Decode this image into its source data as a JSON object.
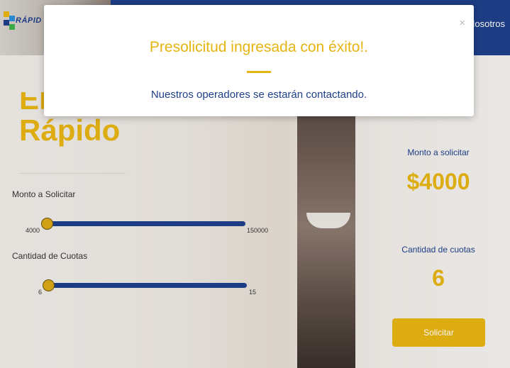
{
  "header": {
    "logo_text": "RÁPID",
    "nav_link": "Nosotros"
  },
  "hero": {
    "title_line1": "Elegí y",
    "title_line2": "Rápido"
  },
  "form": {
    "amount": {
      "label": "Monto a Solicitar",
      "min_label": "4000",
      "max_label": "150000",
      "value": 4000
    },
    "installments": {
      "label": "Cantidad de Cuotas",
      "min_label": "6",
      "max_label": "15",
      "value": 6
    }
  },
  "summary": {
    "amount_label": "Monto a solicitar",
    "amount_value": "$4000",
    "installments_label": "Cantidad de cuotas",
    "installments_value": "6",
    "submit_label": "Solicitar"
  },
  "modal": {
    "close_label": "×",
    "title": "Presolicitud ingresada con éxito!.",
    "message": "Nuestros operadores se estarán contactando."
  },
  "colors": {
    "brand_blue": "#1e3f8a",
    "brand_yellow": "#e6b411"
  }
}
